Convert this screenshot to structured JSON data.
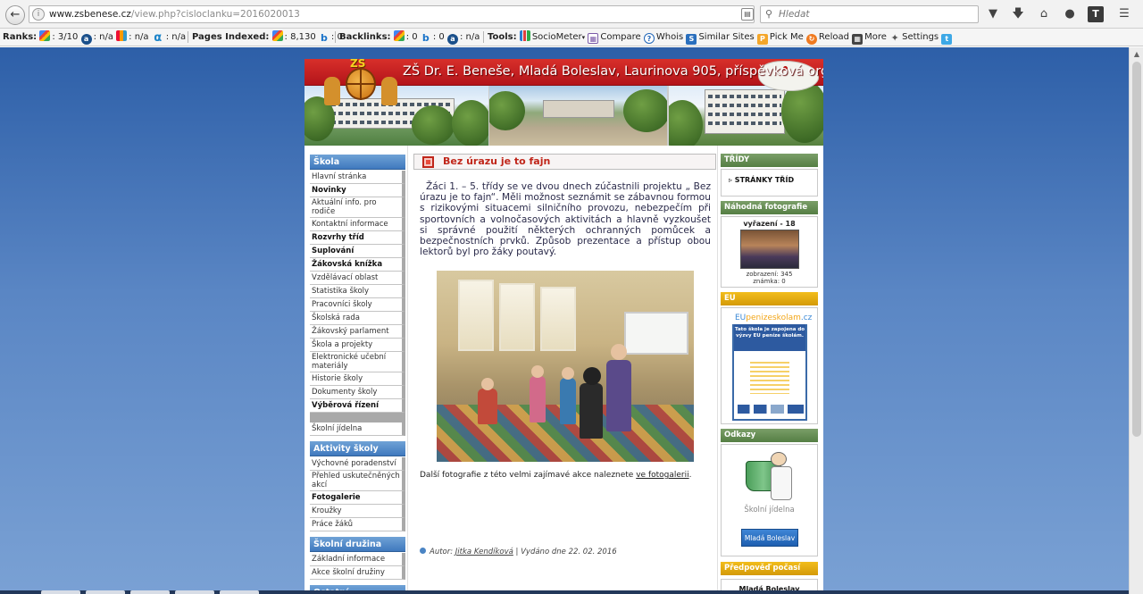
{
  "browser": {
    "url_host": "www.zsbenese.cz",
    "url_path": "/view.php?cisloclanku=2016020013",
    "search_placeholder": "Hledat",
    "toolbar_icons": [
      "back-icon",
      "reader-view-icon",
      "reload-icon",
      "pocket-icon",
      "download-icon",
      "home-icon",
      "chat-icon",
      "t-extension-icon",
      "menu-icon"
    ]
  },
  "seoquake": {
    "ranks_label": "Ranks:",
    "google_rank": ": 3/10",
    "alexa_rank": ": n/a",
    "majestic_rank": ": n/a",
    "alpha_rank": ": n/a",
    "pages_indexed_label": "Pages Indexed:",
    "google_indexed": ": 8,130",
    "bing_indexed": ": 0",
    "backlinks_label": "Backlinks:",
    "google_backlinks": ": 0",
    "bing_backlinks": ": 0",
    "alexa_backlinks": ": n/a",
    "tools_label": "Tools:",
    "tools": [
      "SocioMeter",
      "Compare",
      "Whois",
      "Similar Sites",
      "Pick Me",
      "Reload",
      "More",
      "Settings"
    ]
  },
  "site": {
    "title": "ZŠ Dr. E. Beneše, Mladá Boleslav, Laurinova 905, příspěvková organizace",
    "logo_text": "ZŠ",
    "left_nav": [
      {
        "type": "section",
        "label": "Škola"
      },
      {
        "type": "item",
        "label": "Hlavní stránka",
        "bold": false
      },
      {
        "type": "item",
        "label": "Novinky",
        "bold": true
      },
      {
        "type": "item",
        "label": "Aktuální info. pro rodiče",
        "bold": false
      },
      {
        "type": "item",
        "label": "Kontaktní informace",
        "bold": false
      },
      {
        "type": "item",
        "label": "Rozvrhy tříd",
        "bold": true
      },
      {
        "type": "item",
        "label": "Suplování",
        "bold": true
      },
      {
        "type": "item",
        "label": "Žákovská knížka",
        "bold": true
      },
      {
        "type": "item",
        "label": "Vzdělávací oblast",
        "bold": false
      },
      {
        "type": "item",
        "label": "Statistika školy",
        "bold": false
      },
      {
        "type": "item",
        "label": "Pracovníci školy",
        "bold": false
      },
      {
        "type": "item",
        "label": "Školská rada",
        "bold": false
      },
      {
        "type": "item",
        "label": "Žákovský parlament",
        "bold": false
      },
      {
        "type": "item",
        "label": "Škola a projekty",
        "bold": false
      },
      {
        "type": "item",
        "label": "Elektronické učební materiály",
        "bold": false
      },
      {
        "type": "item",
        "label": "Historie školy",
        "bold": false
      },
      {
        "type": "item",
        "label": "Dokumenty školy",
        "bold": false
      },
      {
        "type": "item",
        "label": "Výběrová řízení",
        "bold": true
      },
      {
        "type": "item",
        "label": "Školní jídelna",
        "bold": false
      },
      {
        "type": "section",
        "label": "Aktivity školy"
      },
      {
        "type": "item",
        "label": "Výchovné poradenství",
        "bold": false
      },
      {
        "type": "item",
        "label": "Přehled uskutečněných akcí",
        "bold": false
      },
      {
        "type": "item",
        "label": "Fotogalerie",
        "bold": true
      },
      {
        "type": "item",
        "label": "Kroužky",
        "bold": false
      },
      {
        "type": "item",
        "label": "Práce žáků",
        "bold": false
      },
      {
        "type": "section",
        "label": "Školní družina"
      },
      {
        "type": "item",
        "label": "Základní informace",
        "bold": false
      },
      {
        "type": "item",
        "label": "Akce školní družiny",
        "bold": false
      },
      {
        "type": "section",
        "label": "Ostatní"
      }
    ],
    "article": {
      "title": "Bez úrazu je to fajn",
      "body": "Žáci 1. – 5. třídy se ve dvou dnech zúčastnili projektu „ Bez úrazu je to fajn“. Měli možnost seznámit se zábavnou formou s rizikovými situacemi silničního provozu, nebezpečím při sportovních a volnočasových aktivitách a hlavně vyzkoušet si správné použití některých ochranných pomůcek a bezpečnostních prvků. Způsob prezentace a přístup obou lektorů byl pro žáky poutavý.",
      "more_text": "Další fotografie z této velmi zajímavé akce naleznete ",
      "more_link": "ve fotogalerii",
      "more_end": ".",
      "meta_author_label": "Autor: ",
      "meta_author": "Jitka Kendíková",
      "meta_published": " | Vydáno dne 22. 02. 2016"
    },
    "right": {
      "tridy_head": "TŘÍDY",
      "tridy_link": "▹ STRÁNKY TŘÍD",
      "photo_head": "Náhodná fotografie",
      "photo_title": "vyřazení - 18",
      "photo_views": "zobrazení: 345",
      "photo_grade": "známka: 0",
      "eu_head": "EU",
      "eu_brand_a": "EU",
      "eu_brand_b": "penizeskolam",
      "eu_brand_c": ".cz",
      "eu_text": "Tato škola je zapojena do výzvy EU peníze školám.",
      "odkazy_head": "Odkazy",
      "jidelna_caption": "Školní jídelna",
      "mb_badge": "Mladá Boleslav",
      "weather_head": "Předpověď počasí",
      "weather_city": "Mladá Boleslav"
    }
  }
}
